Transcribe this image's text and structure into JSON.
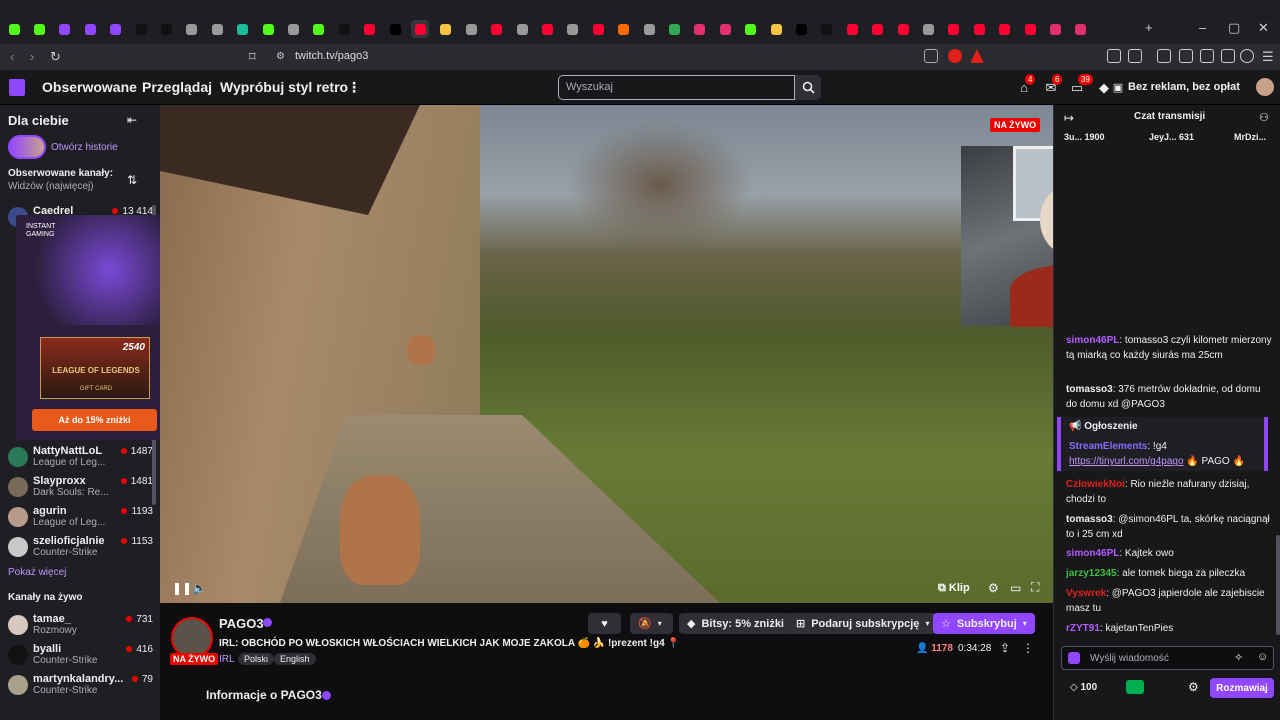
{
  "browser": {
    "url": "twitch.tv/pago3",
    "tabs": [
      "k",
      "k",
      "p",
      "p",
      "p",
      "tt",
      "tt",
      "g",
      "g",
      "o",
      "k",
      "g",
      "k",
      "tt",
      "yt",
      "x",
      "yt",
      "s",
      "g",
      "yt",
      "g",
      "yt",
      "g",
      "yt",
      "c",
      "g",
      "m",
      "ig",
      "ig",
      "k",
      "s",
      "x",
      "tt",
      "yt",
      "yt",
      "yt",
      "g",
      "yt",
      "yt",
      "yt",
      "yt",
      "ig",
      "ig"
    ]
  },
  "nav": {
    "followed": "Obserwowane",
    "browse": "Przeglądaj",
    "retro": "Wypróbuj styl retro",
    "search_placeholder": "Wyszukaj",
    "badge_inbox": "4",
    "badge_whispers": "6",
    "badge_notifications": "39",
    "no_ads": "Bez reklam, bez opłat"
  },
  "sidebar": {
    "title": "Dla ciebie",
    "stories": "Otwórz historie",
    "followed_label": "Obserwowane kanały:",
    "sort_label": "Widzów (najwięcej)",
    "followed": [
      {
        "name": "Caedrel",
        "game": "",
        "viewers": "13 414"
      },
      {
        "name": "NattyNattLoL",
        "game": "League of Leg...",
        "viewers": "1487"
      },
      {
        "name": "Slayproxx",
        "game": "Dark Souls: Re...",
        "viewers": "1481"
      },
      {
        "name": "agurin",
        "game": "League of Leg...",
        "viewers": "1193"
      },
      {
        "name": "szelioficjalnie",
        "game": "Counter-Strike",
        "viewers": "1153"
      }
    ],
    "show_more": "Pokaż więcej",
    "live_label": "Kanały na żywo",
    "live": [
      {
        "name": "tamae_",
        "game": "Rozmowy",
        "viewers": "731"
      },
      {
        "name": "byalli",
        "game": "Counter-Strike",
        "viewers": "416"
      },
      {
        "name": "martynkalandry...",
        "game": "Counter-Strike",
        "viewers": "79"
      }
    ],
    "ad": {
      "brand": "INSTANT GAMING",
      "price": "2540",
      "product": "LEAGUE OF LEGENDS",
      "card": "GIFT CARD",
      "cta": "Aż do 15% zniżki"
    }
  },
  "player": {
    "live": "NA ŻYWO",
    "clip": "Klip"
  },
  "stream": {
    "channel": "PAGO3",
    "title": "IRL: OBCHÓD PO WŁOSKICH WŁOŚCIACH WIELKICH JAK MOJE ZAKOLA 🍊 🍌 !prezent !g4 📍",
    "category": "IRL",
    "tags": [
      "Polski",
      "English"
    ],
    "live": "NA ŻYWO",
    "bits": "Bitsy: 5% zniżki",
    "gift": "Podaruj subskrypcję",
    "subscribe": "Subskrybuj",
    "viewers": "1178",
    "uptime": "0:34:28",
    "about": "Informacje o PAGO3"
  },
  "chat": {
    "title": "Czat transmisji",
    "leaders": [
      {
        "name": "3u...",
        "value": "1900"
      },
      {
        "name": "JeyJ...",
        "value": "631"
      },
      {
        "name": "MrDzi...",
        "value": ""
      }
    ],
    "messages": [
      {
        "user": "simon46PL",
        "color": "#b45cff",
        "text": ": tomasso3 czyli kilometr mierzony tą miarką co każdy siurás ma 25cm"
      },
      {
        "user": "tomasso3",
        "color": "#efeff1",
        "text": ": 376 metrów dokładnie, od domu do domu xd @PAGO3"
      },
      {
        "user": "CzlowiekNoi",
        "color": "#e0201a",
        "text": ": Rio nieźle nafurany dzisiaj, chodzi to"
      },
      {
        "user": "tomasso3",
        "color": "#efeff1",
        "text": ": @simon46PL ta, skórkę naciągnął to i 25 cm xd"
      },
      {
        "user": "simon46PL",
        "color": "#b45cff",
        "text": ": Kajtek owo"
      },
      {
        "user": "jarzy12345",
        "color": "#3fbf3f",
        "text": ": ale tomek biega za pileczka"
      },
      {
        "user": "Vyswrek",
        "color": "#e0201a",
        "text": ": @PAGO3 japierdole ale zajebiscie masz tu"
      },
      {
        "user": "rZYT91",
        "color": "#b45cff",
        "text": ": kajetanTenPies"
      }
    ],
    "announcement": {
      "label": "Ogłoszenie",
      "user": "StreamElements",
      "text": ": !g4",
      "link": "https://tinyurl.com/g4pago",
      "suffix": "🔥 PAGO 🔥"
    },
    "input_placeholder": "Wyślij wiadomość",
    "points": "100",
    "send": "Rozmawiaj"
  }
}
